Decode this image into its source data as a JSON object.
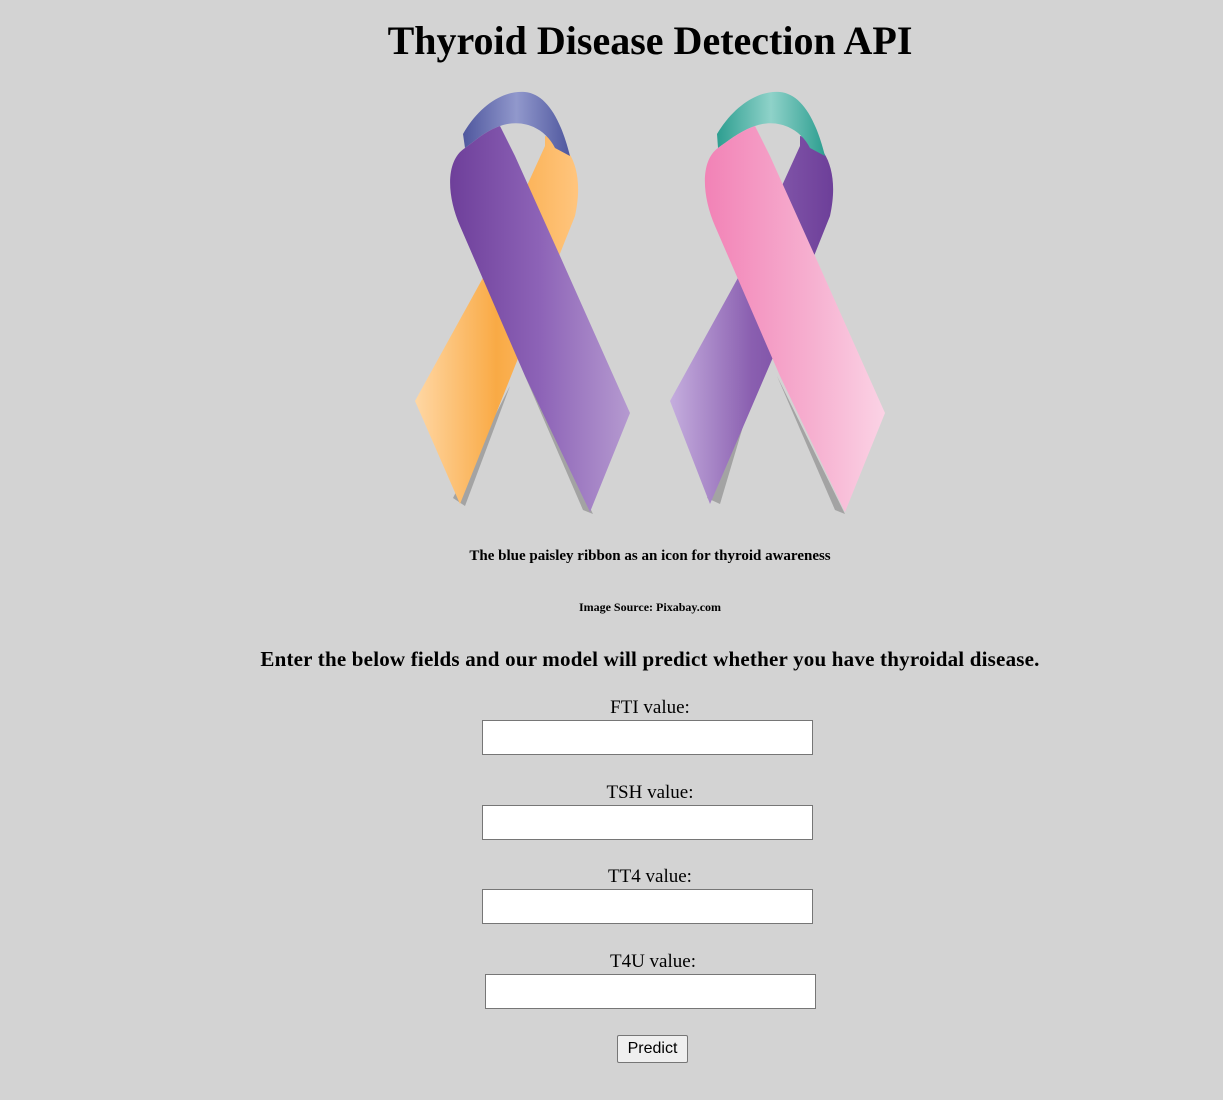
{
  "header": {
    "title": "Thyroid Disease Detection API"
  },
  "hero": {
    "caption": "The blue paisley ribbon as an icon for thyroid awareness",
    "source": "Image Source: Pixabay.com"
  },
  "form": {
    "instructions": "Enter the below fields and our model will predict whether you have thyroidal disease.",
    "fields": [
      {
        "label": "FTI value:",
        "value": ""
      },
      {
        "label": "TSH value:",
        "value": ""
      },
      {
        "label": "TT4 value:",
        "value": ""
      },
      {
        "label": "T4U value:",
        "value": ""
      }
    ],
    "submit_label": "Predict"
  },
  "colors": {
    "background": "#d3d3d3",
    "ribbon_purple": "#8a5fb0",
    "ribbon_orange": "#f8b35a",
    "ribbon_pink": "#f59ac4",
    "ribbon_teal": "#3fb5a6",
    "ribbon_blue": "#6a72b8"
  }
}
